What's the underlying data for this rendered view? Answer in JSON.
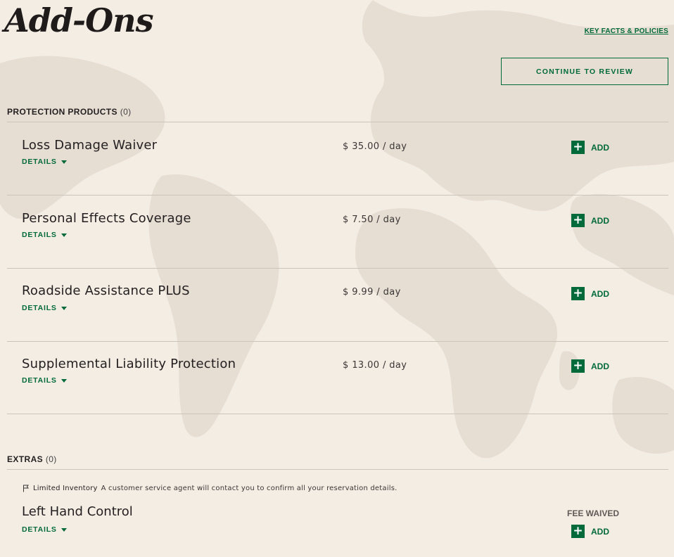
{
  "page": {
    "title": "Add-Ons",
    "key_facts_link": "KEY FACTS & POLICIES",
    "continue_label": "CONTINUE TO REVIEW"
  },
  "protection": {
    "header": "PROTECTION PRODUCTS",
    "count": "(0)",
    "items": [
      {
        "name": "Loss Damage Waiver",
        "price": "$ 35.00 / day",
        "details": "DETAILS",
        "add": "ADD"
      },
      {
        "name": "Personal Effects Coverage",
        "price": "$ 7.50 / day",
        "details": "DETAILS",
        "add": "ADD"
      },
      {
        "name": "Roadside Assistance PLUS",
        "price": "$ 9.99 / day",
        "details": "DETAILS",
        "add": "ADD"
      },
      {
        "name": "Supplemental Liability Protection",
        "price": "$ 13.00 / day",
        "details": "DETAILS",
        "add": "ADD"
      }
    ]
  },
  "extras": {
    "header": "EXTRAS",
    "count": "(0)",
    "notice_label": "Limited Inventory",
    "notice_text": "A customer service agent will contact you to confirm all your reservation details.",
    "items": [
      {
        "name": "Left Hand Control",
        "fee_note": "FEE WAIVED",
        "details": "DETAILS",
        "add": "ADD"
      }
    ]
  },
  "colors": {
    "background": "#f4ede4",
    "accent": "#006a3a",
    "text": "#231f20",
    "divider": "#cbc4bb"
  },
  "icons": {
    "add": "plus-icon",
    "details": "caret-down-icon",
    "notice": "flag-icon"
  }
}
